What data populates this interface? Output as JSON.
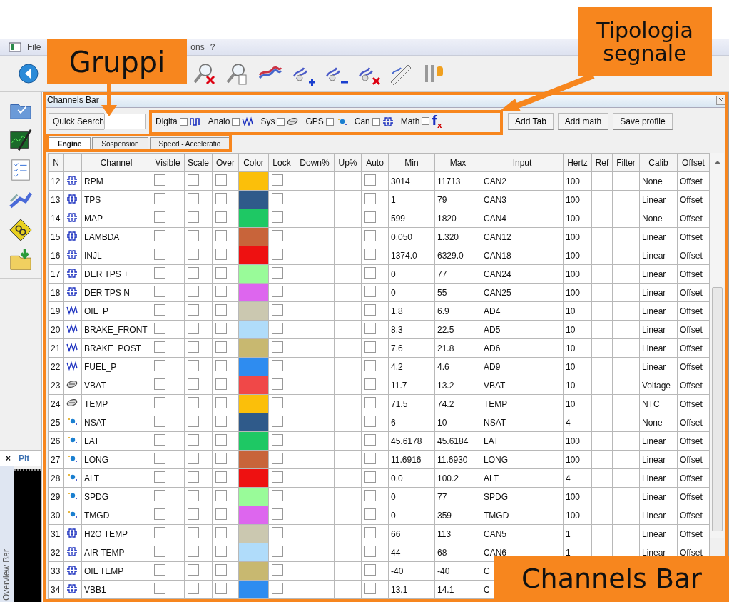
{
  "menu": [
    "File",
    "ons",
    "?"
  ],
  "sidebar_panel": {
    "close": "×",
    "tab": "Pit",
    "title": "Overview Bar"
  },
  "panel": {
    "title": "Channels Bar"
  },
  "search": {
    "label": "Quick Search"
  },
  "filters": [
    {
      "kind": "digital",
      "label": "Digita",
      "checked": false
    },
    {
      "kind": "analog",
      "label": "Analo",
      "checked": false
    },
    {
      "kind": "sys",
      "label": "Sys",
      "checked": false
    },
    {
      "kind": "gps",
      "label": "GPS",
      "checked": false
    },
    {
      "kind": "can",
      "label": "Can",
      "checked": false
    },
    {
      "kind": "math",
      "label": "Math",
      "checked": false,
      "symbol": "f$_{x}$"
    }
  ],
  "buttons": [
    "Add Tab",
    "Add math",
    "Save profile"
  ],
  "tabs": [
    {
      "label": "Engine",
      "selected": true
    },
    {
      "label": "Sospension",
      "selected": false
    },
    {
      "label": "Speed - Acceleratio",
      "selected": false
    }
  ],
  "table": {
    "columns": [
      "N",
      "Channel",
      "Visible",
      "Scale",
      "Over",
      "Color",
      "Lock",
      "Down%",
      "Up%",
      "Auto",
      "Min",
      "Max",
      "Input",
      "Hertz",
      "Ref",
      "Filter",
      "Calib",
      "Offset"
    ],
    "rows": [
      {
        "n": "12",
        "kind": "can",
        "channel": "RPM",
        "visible": false,
        "scale": false,
        "over": false,
        "color": "#fbbf0a",
        "lock": false,
        "auto": false,
        "min": "3014",
        "max": "11713",
        "input": "CAN2",
        "hertz": "100",
        "calib": "None",
        "offset": "Offset"
      },
      {
        "n": "13",
        "kind": "can",
        "channel": "TPS",
        "visible": false,
        "scale": false,
        "over": false,
        "color": "#2f5a8a",
        "lock": false,
        "auto": false,
        "min": "1",
        "max": "79",
        "input": "CAN3",
        "hertz": "100",
        "calib": "Linear",
        "offset": "Offset"
      },
      {
        "n": "14",
        "kind": "can",
        "channel": "MAP",
        "visible": false,
        "scale": false,
        "over": false,
        "color": "#1ec864",
        "lock": false,
        "auto": false,
        "min": "599",
        "max": "1820",
        "input": "CAN4",
        "hertz": "100",
        "calib": "None",
        "offset": "Offset"
      },
      {
        "n": "15",
        "kind": "can",
        "channel": "LAMBDA",
        "visible": false,
        "scale": false,
        "over": false,
        "color": "#c8643a",
        "lock": false,
        "auto": false,
        "min": "0.050",
        "max": "1.320",
        "input": "CAN12",
        "hertz": "100",
        "calib": "Linear",
        "offset": "Offset"
      },
      {
        "n": "16",
        "kind": "can",
        "channel": "INJL",
        "visible": false,
        "scale": false,
        "over": false,
        "color": "#ee1111",
        "lock": false,
        "auto": false,
        "min": "1374.0",
        "max": "6329.0",
        "input": "CAN18",
        "hertz": "100",
        "calib": "Linear",
        "offset": "Offset"
      },
      {
        "n": "17",
        "kind": "can",
        "channel": "DER TPS +",
        "visible": false,
        "scale": false,
        "over": false,
        "color": "#99fb99",
        "lock": false,
        "auto": false,
        "min": "0",
        "max": "77",
        "input": "CAN24",
        "hertz": "100",
        "calib": "Linear",
        "offset": "Offset"
      },
      {
        "n": "18",
        "kind": "can",
        "channel": "DER TPS N",
        "visible": false,
        "scale": false,
        "over": false,
        "color": "#dd66ee",
        "lock": false,
        "auto": false,
        "min": "0",
        "max": "55",
        "input": "CAN25",
        "hertz": "100",
        "calib": "Linear",
        "offset": "Offset"
      },
      {
        "n": "19",
        "kind": "analog",
        "channel": "OIL_P",
        "visible": false,
        "scale": false,
        "over": false,
        "color": "#cbc8b0",
        "lock": false,
        "auto": false,
        "min": "1.8",
        "max": "6.9",
        "input": "AD4",
        "hertz": "10",
        "calib": "Linear",
        "offset": "Offset"
      },
      {
        "n": "20",
        "kind": "analog",
        "channel": "BRAKE_FRONT",
        "visible": false,
        "scale": false,
        "over": false,
        "color": "#b0dcfa",
        "lock": false,
        "auto": false,
        "min": "8.3",
        "max": "22.5",
        "input": "AD5",
        "hertz": "10",
        "calib": "Linear",
        "offset": "Offset"
      },
      {
        "n": "21",
        "kind": "analog",
        "channel": "BRAKE_POST",
        "visible": false,
        "scale": false,
        "over": false,
        "color": "#c8b870",
        "lock": false,
        "auto": false,
        "min": "7.6",
        "max": "21.8",
        "input": "AD6",
        "hertz": "10",
        "calib": "Linear",
        "offset": "Offset"
      },
      {
        "n": "22",
        "kind": "analog",
        "channel": "FUEL_P",
        "visible": false,
        "scale": false,
        "over": false,
        "color": "#2e8cf0",
        "lock": false,
        "auto": false,
        "min": "4.2",
        "max": "4.6",
        "input": "AD9",
        "hertz": "10",
        "calib": "Linear",
        "offset": "Offset"
      },
      {
        "n": "23",
        "kind": "sys",
        "channel": "VBAT",
        "visible": false,
        "scale": false,
        "over": false,
        "color": "#f04848",
        "lock": false,
        "auto": false,
        "min": "11.7",
        "max": "13.2",
        "input": "VBAT",
        "hertz": "10",
        "calib": "Voltage",
        "offset": "Offset"
      },
      {
        "n": "24",
        "kind": "sys",
        "channel": "TEMP",
        "visible": false,
        "scale": false,
        "over": false,
        "color": "#fbbf0a",
        "lock": false,
        "auto": false,
        "min": "71.5",
        "max": "74.2",
        "input": "TEMP",
        "hertz": "10",
        "calib": "NTC",
        "offset": "Offset"
      },
      {
        "n": "25",
        "kind": "gps",
        "channel": "NSAT",
        "visible": false,
        "scale": false,
        "over": false,
        "color": "#2f5a8a",
        "lock": false,
        "auto": false,
        "min": "6",
        "max": "10",
        "input": "NSAT",
        "hertz": "4",
        "calib": "None",
        "offset": "Offset"
      },
      {
        "n": "26",
        "kind": "gps",
        "channel": "LAT",
        "visible": false,
        "scale": false,
        "over": false,
        "color": "#1ec864",
        "lock": false,
        "auto": false,
        "min": "45.6178",
        "max": "45.6184",
        "input": "LAT",
        "hertz": "100",
        "calib": "Linear",
        "offset": "Offset"
      },
      {
        "n": "27",
        "kind": "gps",
        "channel": "LONG",
        "visible": false,
        "scale": false,
        "over": false,
        "color": "#c8643a",
        "lock": false,
        "auto": false,
        "min": "11.6916",
        "max": "11.6930",
        "input": "LONG",
        "hertz": "100",
        "calib": "Linear",
        "offset": "Offset"
      },
      {
        "n": "28",
        "kind": "gps",
        "channel": "ALT",
        "visible": false,
        "scale": false,
        "over": false,
        "color": "#ee1111",
        "lock": false,
        "auto": false,
        "min": "0.0",
        "max": "100.2",
        "input": "ALT",
        "hertz": "4",
        "calib": "Linear",
        "offset": "Offset"
      },
      {
        "n": "29",
        "kind": "gps",
        "channel": "SPDG",
        "visible": false,
        "scale": false,
        "over": false,
        "color": "#99fb99",
        "lock": false,
        "auto": false,
        "min": "0",
        "max": "77",
        "input": "SPDG",
        "hertz": "100",
        "calib": "Linear",
        "offset": "Offset"
      },
      {
        "n": "30",
        "kind": "gps",
        "channel": "TMGD",
        "visible": false,
        "scale": false,
        "over": false,
        "color": "#dd66ee",
        "lock": false,
        "auto": false,
        "min": "0",
        "max": "359",
        "input": "TMGD",
        "hertz": "100",
        "calib": "Linear",
        "offset": "Offset"
      },
      {
        "n": "31",
        "kind": "can",
        "channel": "H2O TEMP",
        "visible": false,
        "scale": false,
        "over": false,
        "color": "#cbc8b0",
        "lock": false,
        "auto": false,
        "min": "66",
        "max": "113",
        "input": "CAN5",
        "hertz": "1",
        "calib": "Linear",
        "offset": "Offset"
      },
      {
        "n": "32",
        "kind": "can",
        "channel": "AIR TEMP",
        "visible": false,
        "scale": false,
        "over": false,
        "color": "#b0dcfa",
        "lock": false,
        "auto": false,
        "min": "44",
        "max": "68",
        "input": "CAN6",
        "hertz": "1",
        "calib": "Linear",
        "offset": "Offset"
      },
      {
        "n": "33",
        "kind": "can",
        "channel": "OIL TEMP",
        "visible": false,
        "scale": false,
        "over": false,
        "color": "#c8b870",
        "lock": false,
        "auto": false,
        "min": "-40",
        "max": "-40",
        "input": "C"
      },
      {
        "n": "34",
        "kind": "can",
        "channel": "VBB1",
        "visible": false,
        "scale": false,
        "over": false,
        "color": "#2e8cf0",
        "lock": false,
        "auto": false,
        "min": "13.1",
        "max": "14.1",
        "input": "C"
      }
    ]
  },
  "annotations": [
    {
      "text": "Gruppi"
    },
    {
      "text": "Tipologia segnale"
    },
    {
      "text": "Channels Bar"
    }
  ]
}
